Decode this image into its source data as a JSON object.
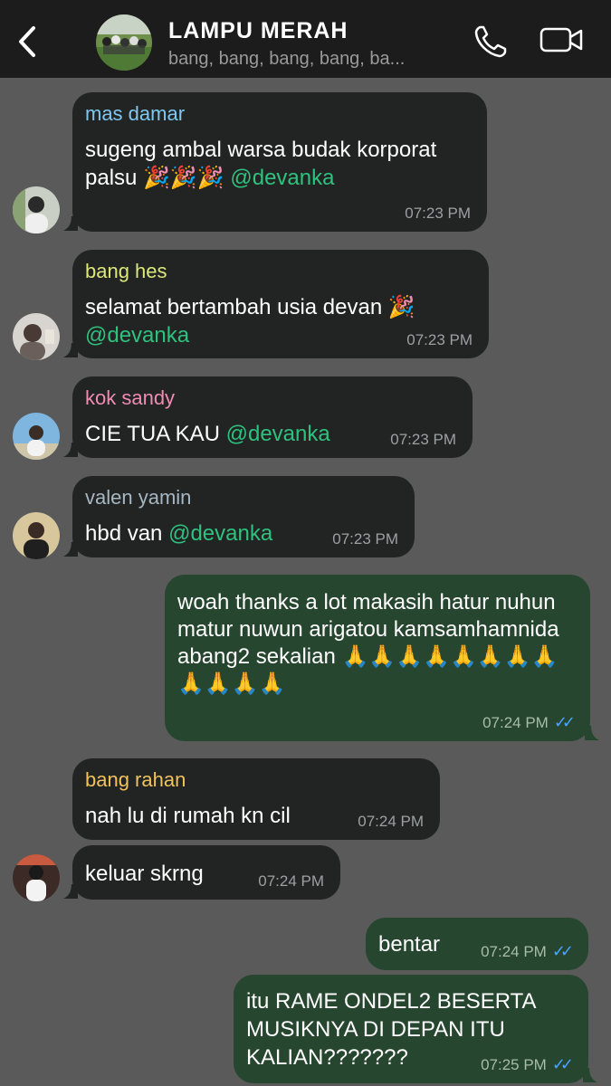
{
  "header": {
    "title": "LAMPU MERAH",
    "members": "bang, bang, bang, bang, ba..."
  },
  "messages": [
    {
      "sender": "mas damar",
      "sender_color": "#7ec8f0",
      "text": "sugeng ambal warsa budak korporat palsu 🎉🎉🎉",
      "mention": "@devanka",
      "time": "07:23 PM"
    },
    {
      "sender": "bang hes",
      "sender_color": "#dde77a",
      "text": "selamat bertambah usia devan 🎉",
      "mention": "@devanka",
      "time": "07:23 PM"
    },
    {
      "sender": "kok sandy",
      "sender_color": "#f08bb2",
      "text": "CIE TUA KAU",
      "mention": "@devanka",
      "time": "07:23 PM"
    },
    {
      "sender": "valen yamin",
      "sender_color": "#a7b7c2",
      "text": "hbd van",
      "mention": "@devanka",
      "time": "07:23 PM"
    },
    {
      "text": "woah thanks a lot makasih hatur nuhun matur nuwun arigatou kamsamhamnida abang2 sekalian 🙏🙏🙏🙏🙏🙏🙏🙏🙏🙏🙏🙏",
      "time": "07:24 PM"
    },
    {
      "sender": "bang rahan",
      "sender_color": "#f0c25c",
      "text": "nah lu di rumah kn cil",
      "time": "07:24 PM"
    },
    {
      "text": "keluar skrng",
      "time": "07:24 PM"
    },
    {
      "text": "bentar",
      "time": "07:24 PM"
    },
    {
      "text": "itu RAME ONDEL2 BESERTA MUSIKNYA DI DEPAN ITU KALIAN???????",
      "time": "07:25 PM"
    }
  ]
}
